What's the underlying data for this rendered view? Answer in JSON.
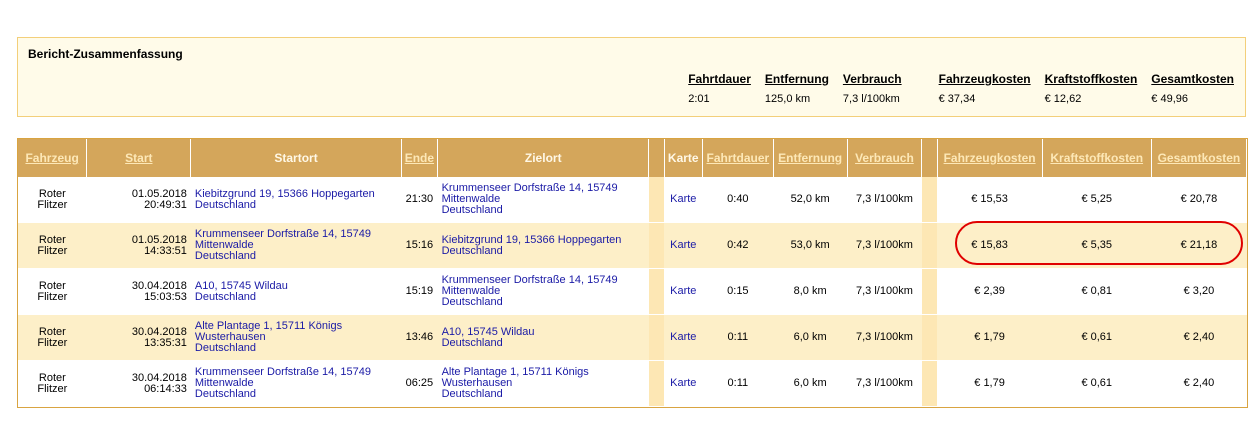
{
  "summary": {
    "title": "Bericht-Zusammenfassung",
    "headers": [
      "Fahrtdauer",
      "Entfernung",
      "Verbrauch",
      "Fahrzeugkosten",
      "Kraftstoffkosten",
      "Gesamtkosten"
    ],
    "values": [
      "2:01",
      "125,0 km",
      "7,3 l/100km",
      "€ 37,34",
      "€ 12,62",
      "€ 49,96"
    ]
  },
  "table": {
    "headers": {
      "fahrzeug": "Fahrzeug",
      "start": "Start",
      "startort": "Startort",
      "ende": "Ende",
      "zielort": "Zielort",
      "karte": "Karte",
      "fahrtdauer": "Fahrtdauer",
      "entfernung": "Entfernung",
      "verbrauch": "Verbrauch",
      "fahrzeugkosten": "Fahrzeugkosten",
      "kraftstoffkosten": "Kraftstoffkosten",
      "gesamtkosten": "Gesamtkosten"
    },
    "rows": [
      {
        "fahrzeug": "Roter Flitzer",
        "start_date": "01.05.2018",
        "start_time": "20:49:31",
        "startort_1": "Kiebitzgrund 19, 15366 Hoppegarten",
        "startort_2": "",
        "startort_3": "Deutschland",
        "ende": "21:30",
        "zielort_1": "Krummenseer Dorfstraße 14, 15749",
        "zielort_2": "Mittenwalde",
        "zielort_3": "Deutschland",
        "karte": "Karte",
        "fahrtdauer": "0:40",
        "entfernung": "52,0 km",
        "verbrauch": "7,3 l/100km",
        "fahrzeugkosten": "€ 15,53",
        "kraftstoffkosten": "€ 5,25",
        "gesamtkosten": "€ 20,78"
      },
      {
        "fahrzeug": "Roter Flitzer",
        "start_date": "01.05.2018",
        "start_time": "14:33:51",
        "startort_1": "Krummenseer Dorfstraße 14, 15749",
        "startort_2": "Mittenwalde",
        "startort_3": "Deutschland",
        "ende": "15:16",
        "zielort_1": "Kiebitzgrund 19, 15366 Hoppegarten",
        "zielort_2": "",
        "zielort_3": "Deutschland",
        "karte": "Karte",
        "fahrtdauer": "0:42",
        "entfernung": "53,0 km",
        "verbrauch": "7,3 l/100km",
        "fahrzeugkosten": "€ 15,83",
        "kraftstoffkosten": "€ 5,35",
        "gesamtkosten": "€ 21,18"
      },
      {
        "fahrzeug": "Roter Flitzer",
        "start_date": "30.04.2018",
        "start_time": "15:03:53",
        "startort_1": "A10, 15745 Wildau",
        "startort_2": "",
        "startort_3": "Deutschland",
        "ende": "15:19",
        "zielort_1": "Krummenseer Dorfstraße 14, 15749",
        "zielort_2": "Mittenwalde",
        "zielort_3": "Deutschland",
        "karte": "Karte",
        "fahrtdauer": "0:15",
        "entfernung": "8,0 km",
        "verbrauch": "7,3 l/100km",
        "fahrzeugkosten": "€ 2,39",
        "kraftstoffkosten": "€ 0,81",
        "gesamtkosten": "€ 3,20"
      },
      {
        "fahrzeug": "Roter Flitzer",
        "start_date": "30.04.2018",
        "start_time": "13:35:31",
        "startort_1": "Alte Plantage 1, 15711 Königs",
        "startort_2": "Wusterhausen",
        "startort_3": "Deutschland",
        "ende": "13:46",
        "zielort_1": "A10, 15745 Wildau",
        "zielort_2": "",
        "zielort_3": "Deutschland",
        "karte": "Karte",
        "fahrtdauer": "0:11",
        "entfernung": "6,0 km",
        "verbrauch": "7,3 l/100km",
        "fahrzeugkosten": "€ 1,79",
        "kraftstoffkosten": "€ 0,61",
        "gesamtkosten": "€ 2,40"
      },
      {
        "fahrzeug": "Roter Flitzer",
        "start_date": "30.04.2018",
        "start_time": "06:14:33",
        "startort_1": "Krummenseer Dorfstraße 14, 15749",
        "startort_2": "Mittenwalde",
        "startort_3": "Deutschland",
        "ende": "06:25",
        "zielort_1": "Alte Plantage 1, 15711 Königs",
        "zielort_2": "Wusterhausen",
        "zielort_3": "Deutschland",
        "karte": "Karte",
        "fahrtdauer": "0:11",
        "entfernung": "6,0 km",
        "verbrauch": "7,3 l/100km",
        "fahrzeugkosten": "€ 1,79",
        "kraftstoffkosten": "€ 0,61",
        "gesamtkosten": "€ 2,40"
      }
    ]
  },
  "colors": {
    "header_bg": "#d4a65b",
    "row_alt_bg": "#fdefc8",
    "link": "#1a1aa6",
    "highlight": "#e00000"
  }
}
